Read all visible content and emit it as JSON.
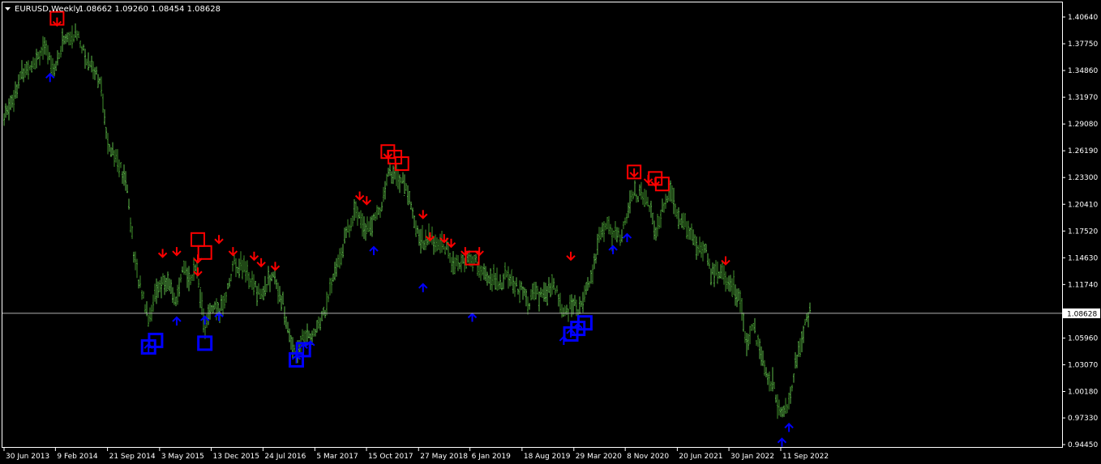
{
  "window": {
    "symbol_title": "EURUSD,Weekly",
    "ohlc": "1.08662 1.09260 1.08454 1.08628",
    "triangle_icon": "triangle-down-icon"
  },
  "colors": {
    "background": "#000000",
    "frame": "#ffffff",
    "bars": "#3f8f2c",
    "bars_light": "#5cb848",
    "bid_line": "#b0b0b0",
    "sell_signal": "#ff0000",
    "buy_signal": "#0000ff",
    "text": "#ffffff"
  },
  "chart_data": {
    "type": "bar",
    "title": "EURUSD,Weekly",
    "current_price": 1.08628,
    "current_price_label": "1.08628",
    "ylim": [
      0.9445,
      1.416
    ],
    "y_ticks": [
      "1.40640",
      "1.37750",
      "1.34860",
      "1.31970",
      "1.29080",
      "1.26190",
      "1.23300",
      "1.20410",
      "1.17520",
      "1.14630",
      "1.11740",
      "1.08850",
      "1.05960",
      "1.03070",
      "1.00180",
      "0.97330",
      "0.94450"
    ],
    "x_tick_labels": [
      "30 Jun 2013",
      "9 Feb 2014",
      "21 Sep 2014",
      "3 May 2015",
      "13 Dec 2015",
      "24 Jul 2016",
      "5 Mar 2017",
      "15 Oct 2017",
      "27 May 2018",
      "6 Jan 2019",
      "18 Aug 2019",
      "29 Mar 2020",
      "8 Nov 2020",
      "20 Jun 2021",
      "30 Jan 2022",
      "11 Sep 2022"
    ],
    "grid": false,
    "price_path": [
      [
        "30 Jun 2013",
        1.296
      ],
      [
        "Sep 2013",
        1.345
      ],
      [
        "Dec 2013",
        1.372
      ],
      [
        "9 Feb 2014",
        1.352
      ],
      [
        "Mar 2014",
        1.385
      ],
      [
        "Apr 2014",
        1.382
      ],
      [
        "May 2014",
        1.39
      ],
      [
        "Jun 2014",
        1.362
      ],
      [
        "Jul 2014",
        1.355
      ],
      [
        "Aug 2014",
        1.34
      ],
      [
        "21 Sep 2014",
        1.275
      ],
      [
        "Oct 2014",
        1.262
      ],
      [
        "Dec 2014",
        1.222
      ],
      [
        "Jan 2015",
        1.142
      ],
      [
        "Mar 2015",
        1.082
      ],
      [
        "3 May 2015",
        1.12
      ],
      [
        "Jun 2015",
        1.117
      ],
      [
        "Jul 2015",
        1.098
      ],
      [
        "Aug 2015",
        1.135
      ],
      [
        "Sep 2015",
        1.126
      ],
      [
        "Oct 2015",
        1.132
      ],
      [
        "Nov 2015",
        1.068
      ],
      [
        "13 Dec 2015",
        1.093
      ],
      [
        "Jan 2016",
        1.086
      ],
      [
        "Feb 2016",
        1.106
      ],
      [
        "Mar 2016",
        1.138
      ],
      [
        "Apr 2016",
        1.138
      ],
      [
        "May 2016",
        1.132
      ],
      [
        "Jun 2016",
        1.115
      ],
      [
        "24 Jul 2016",
        1.106
      ],
      [
        "Aug 2016",
        1.122
      ],
      [
        "Sep 2016",
        1.123
      ],
      [
        "Oct 2016",
        1.1
      ],
      [
        "Nov 2016",
        1.06
      ],
      [
        "Dec 2016",
        1.045
      ],
      [
        "Jan 2017",
        1.062
      ],
      [
        "5 Mar 2017",
        1.063
      ],
      [
        "Apr 2017",
        1.088
      ],
      [
        "May 2017",
        1.116
      ],
      [
        "Jun 2017",
        1.142
      ],
      [
        "Jul 2017",
        1.168
      ],
      [
        "Aug 2017",
        1.192
      ],
      [
        "Sep 2017",
        1.195
      ],
      [
        "15 Oct 2017",
        1.178
      ],
      [
        "Nov 2017",
        1.185
      ],
      [
        "Dec 2017",
        1.198
      ],
      [
        "Jan 2018",
        1.238
      ],
      [
        "Feb 2018",
        1.236
      ],
      [
        "Mar 2018",
        1.23
      ],
      [
        "Apr 2018",
        1.214
      ],
      [
        "27 May 2018",
        1.168
      ],
      [
        "Jun 2018",
        1.165
      ],
      [
        "Jul 2018",
        1.168
      ],
      [
        "Aug 2018",
        1.158
      ],
      [
        "Sep 2018",
        1.162
      ],
      [
        "Oct 2018",
        1.145
      ],
      [
        "Nov 2018",
        1.136
      ],
      [
        "Dec 2018",
        1.142
      ],
      [
        "6 Jan 2019",
        1.146
      ],
      [
        "Feb 2019",
        1.136
      ],
      [
        "Mar 2019",
        1.124
      ],
      [
        "Apr 2019",
        1.122
      ],
      [
        "May 2019",
        1.117
      ],
      [
        "Jun 2019",
        1.131
      ],
      [
        "Jul 2019",
        1.115
      ],
      [
        "18 Aug 2019",
        1.11
      ],
      [
        "Sep 2019",
        1.098
      ],
      [
        "Oct 2019",
        1.108
      ],
      [
        "Nov 2019",
        1.102
      ],
      [
        "Dec 2019",
        1.115
      ],
      [
        "Jan 2020",
        1.11
      ],
      [
        "Feb 2020",
        1.085
      ],
      [
        "29 Mar 2020",
        1.098
      ],
      [
        "Apr 2020",
        1.084
      ],
      [
        "May 2020",
        1.112
      ],
      [
        "Jun 2020",
        1.126
      ],
      [
        "Jul 2020",
        1.166
      ],
      [
        "Aug 2020",
        1.184
      ],
      [
        "Sep 2020",
        1.168
      ],
      [
        "Oct 2020",
        1.172
      ],
      [
        "8 Nov 2020",
        1.183
      ],
      [
        "Dec 2020",
        1.218
      ],
      [
        "Jan 2021",
        1.213
      ],
      [
        "Feb 2021",
        1.21
      ],
      [
        "Mar 2021",
        1.174
      ],
      [
        "Apr 2021",
        1.2
      ],
      [
        "May 2021",
        1.22
      ],
      [
        "20 Jun 2021",
        1.192
      ],
      [
        "Jul 2021",
        1.187
      ],
      [
        "Aug 2021",
        1.175
      ],
      [
        "Sep 2021",
        1.158
      ],
      [
        "Oct 2021",
        1.16
      ],
      [
        "Nov 2021",
        1.13
      ],
      [
        "Dec 2021",
        1.132
      ],
      [
        "30 Jan 2022",
        1.122
      ],
      [
        "Mar 2022",
        1.1
      ],
      [
        "Apr 2022",
        1.054
      ],
      [
        "May 2022",
        1.072
      ],
      [
        "Jun 2022",
        1.042
      ],
      [
        "Jul 2022",
        1.02
      ],
      [
        "Aug 2022",
        1.005
      ],
      [
        "11 Sep 2022",
        0.975
      ],
      [
        "Oct 2022",
        0.988
      ],
      [
        "Nov 2022",
        1.035
      ],
      [
        "Dec 2022",
        1.068
      ],
      [
        "Jan 2023",
        1.086
      ]
    ],
    "sell_arrows": [
      [
        "Feb 2014",
        1.398
      ],
      [
        "May 2015",
        1.148
      ],
      [
        "Jul 2015",
        1.15
      ],
      [
        "Oct 2015",
        1.142
      ],
      [
        "Oct 2015",
        1.128
      ],
      [
        "Jan 2016",
        1.163
      ],
      [
        "Mar 2016",
        1.15
      ],
      [
        "Jun 2016",
        1.145
      ],
      [
        "Jul 2016",
        1.138
      ],
      [
        "Sep 2016",
        1.134
      ],
      [
        "Sep 2017",
        1.21
      ],
      [
        "Oct 2017",
        1.205
      ],
      [
        "Jan 2018",
        1.255
      ],
      [
        "Jun 2018",
        1.19
      ],
      [
        "Jul 2018",
        1.166
      ],
      [
        "Sep 2018",
        1.164
      ],
      [
        "Oct 2018",
        1.159
      ],
      [
        "Dec 2018",
        1.15
      ],
      [
        "Feb 2019",
        1.15
      ],
      [
        "Mar 2020",
        1.145
      ],
      [
        "Dec 2020",
        1.235
      ],
      [
        "Feb 2021",
        1.228
      ],
      [
        "Mar 2021",
        1.225
      ],
      [
        "Jan 2022",
        1.14
      ]
    ],
    "buy_arrows": [
      [
        "Jan 2014",
        1.344
      ],
      [
        "Mar 2015",
        1.052
      ],
      [
        "Jul 2015",
        1.081
      ],
      [
        "Nov 2015",
        1.082
      ],
      [
        "Jan 2016",
        1.086
      ],
      [
        "Dec 2016",
        1.04
      ],
      [
        "Jan 2017",
        1.052
      ],
      [
        "Feb 2017",
        1.055
      ],
      [
        "Nov 2017",
        1.157
      ],
      [
        "Jun 2018",
        1.117
      ],
      [
        "Jan 2019",
        1.085
      ],
      [
        "Feb 2020",
        1.06
      ],
      [
        "Mar 2020",
        1.068
      ],
      [
        "Apr 2020",
        1.074
      ],
      [
        "Sep 2020",
        1.158
      ],
      [
        "Nov 2020",
        1.171
      ],
      [
        "Sep 2022",
        0.95
      ],
      [
        "Oct 2022",
        0.966
      ]
    ],
    "sell_boxes": [
      [
        "Feb 2014",
        1.405
      ],
      [
        "Oct 2015",
        1.166
      ],
      [
        "Nov 2015",
        1.152
      ],
      [
        "Jan 2018",
        1.261
      ],
      [
        "Feb 2018",
        1.255
      ],
      [
        "Mar 2018",
        1.248
      ],
      [
        "Jan 2019",
        1.146
      ],
      [
        "Dec 2020",
        1.239
      ],
      [
        "Mar 2021",
        1.232
      ],
      [
        "Apr 2021",
        1.226
      ]
    ],
    "buy_boxes": [
      [
        "Mar 2015",
        1.05
      ],
      [
        "Apr 2015",
        1.057
      ],
      [
        "Nov 2015",
        1.054
      ],
      [
        "Dec 2016",
        1.036
      ],
      [
        "Jan 2017",
        1.047
      ],
      [
        "Mar 2020",
        1.064
      ],
      [
        "Apr 2020",
        1.07
      ],
      [
        "May 2020",
        1.076
      ]
    ]
  }
}
